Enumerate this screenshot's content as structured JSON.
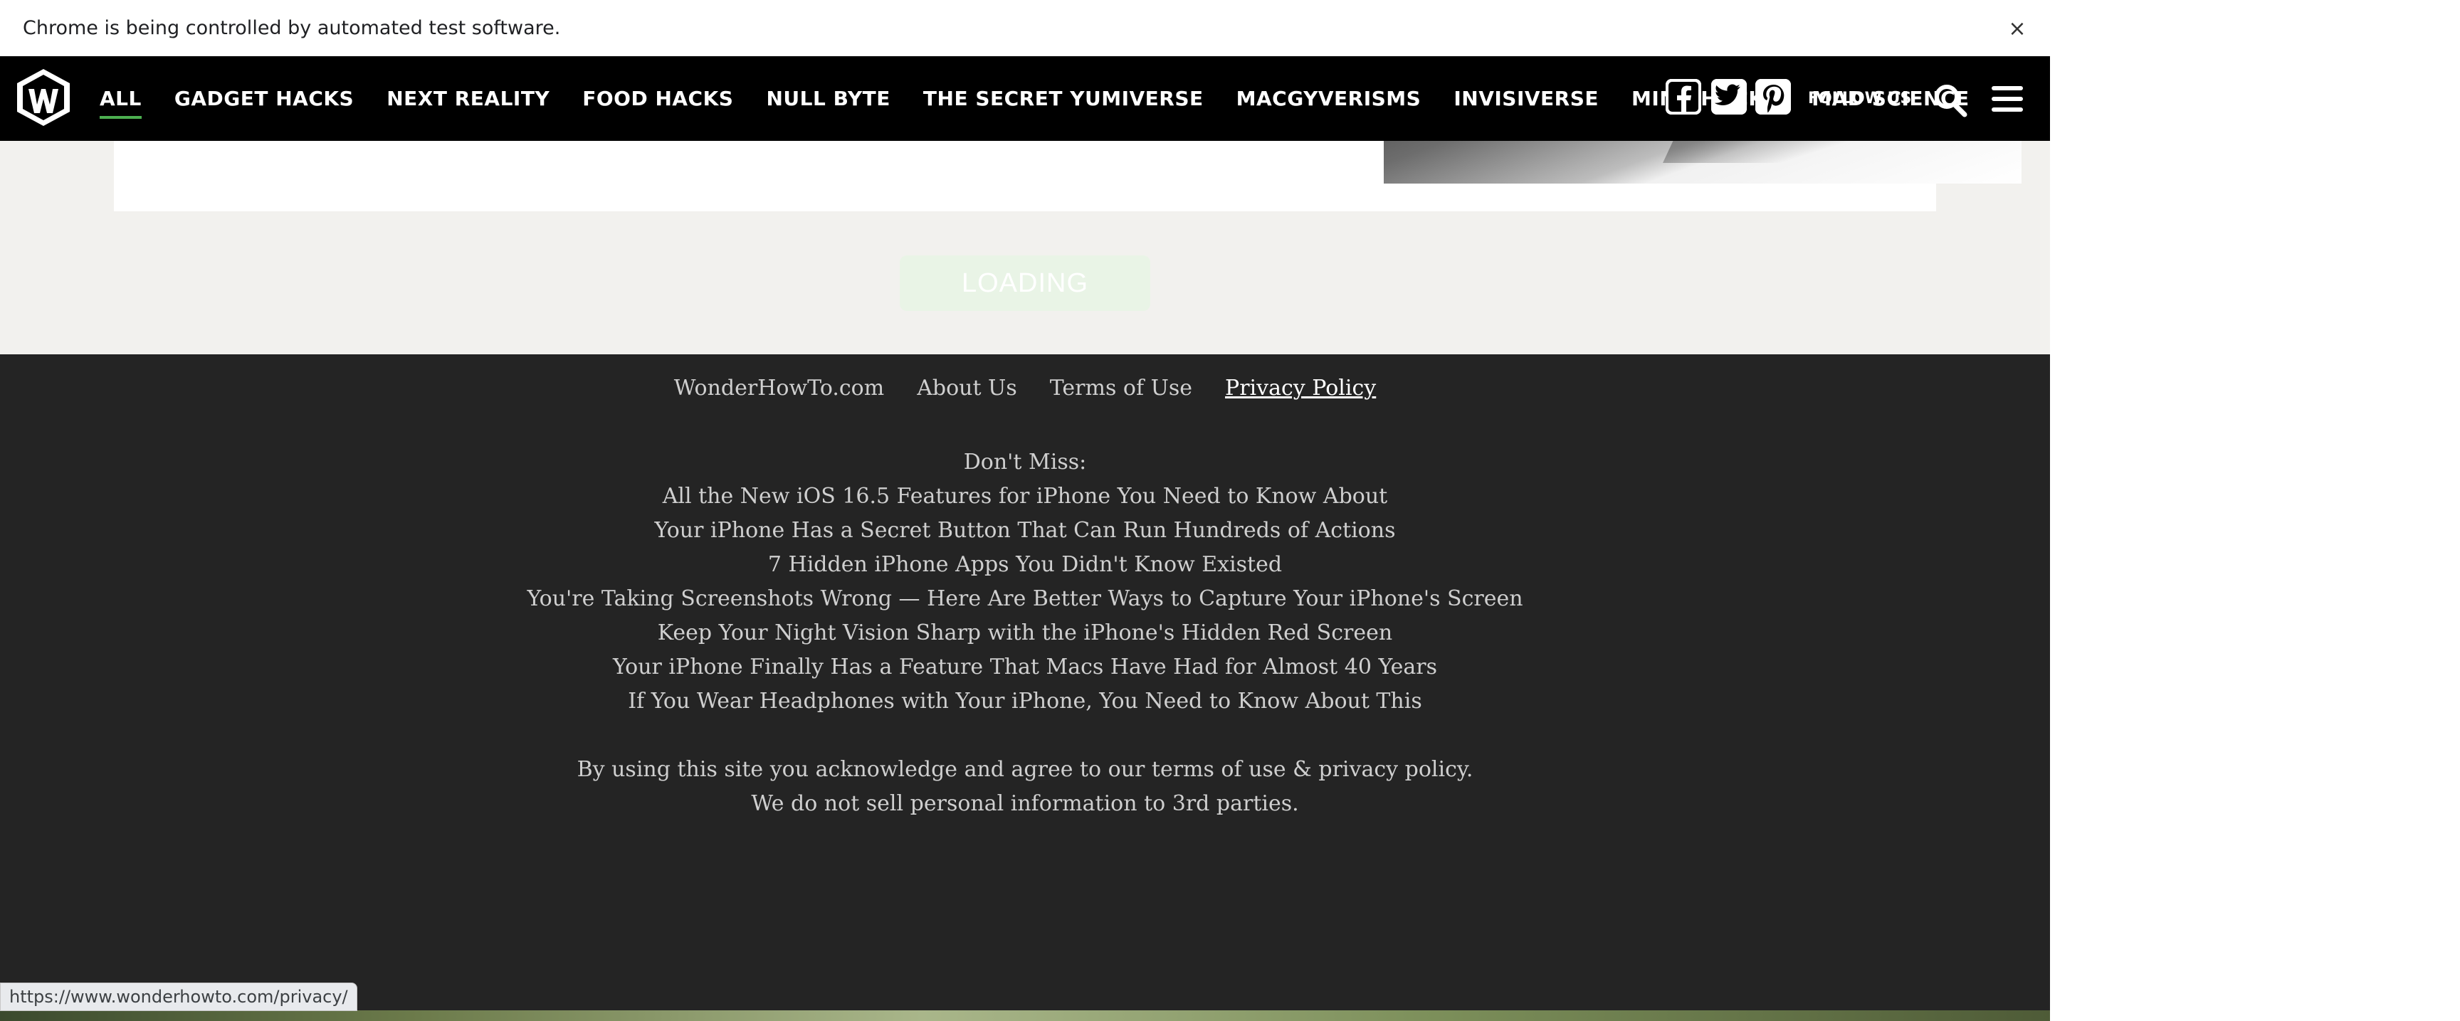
{
  "infobar": {
    "message": "Chrome is being controlled by automated test software.",
    "close_glyph": "×"
  },
  "loading": {
    "label": "LOADING"
  },
  "nav": {
    "items": [
      {
        "label": "ALL",
        "active": true
      },
      {
        "label": "GADGET HACKS"
      },
      {
        "label": "NEXT REALITY"
      },
      {
        "label": "FOOD HACKS"
      },
      {
        "label": "NULL BYTE"
      },
      {
        "label": "THE SECRET YUMIVERSE"
      },
      {
        "label": "MACGYVERISMS"
      },
      {
        "label": "INVISIVERSE"
      },
      {
        "label": "MIND HACKS"
      },
      {
        "label": "MAD SCIENCE"
      }
    ],
    "follow_label": "FOLLOW US",
    "icons": [
      "logo-icon",
      "facebook-icon",
      "twitter-icon",
      "pinterest-icon",
      "search-icon",
      "menu-icon"
    ],
    "accent": "#4caf50"
  },
  "footer": {
    "links": [
      "WonderHowTo.com",
      "About Us",
      "Terms of Use",
      "Privacy Policy"
    ],
    "dont_miss_label": "Don't Miss:",
    "dont_miss": [
      "All the New iOS 16.5 Features for iPhone You Need to Know About",
      "Your iPhone Has a Secret Button That Can Run Hundreds of Actions",
      "7 Hidden iPhone Apps You Didn't Know Existed",
      "You're Taking Screenshots Wrong — Here Are Better Ways to Capture Your iPhone's Screen",
      "Keep Your Night Vision Sharp with the iPhone's Hidden Red Screen",
      "Your iPhone Finally Has a Feature That Macs Have Had for Almost 40 Years",
      "If You Wear Headphones with Your iPhone, You Need to Know About This"
    ],
    "legal_line1": "By using this site you acknowledge and agree to our terms of use & privacy policy.",
    "legal_line2": "We do not sell personal information to 3rd parties."
  },
  "status_bar": {
    "url": "https://www.wonderhowto.com/privacy/"
  }
}
